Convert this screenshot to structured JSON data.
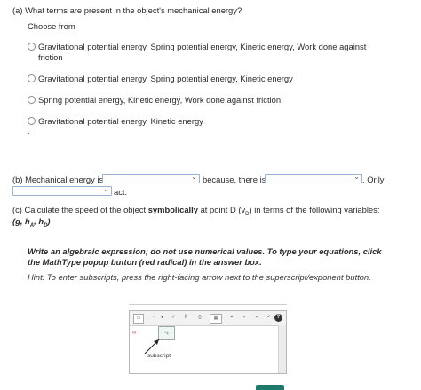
{
  "part_a": {
    "question": "(a) What terms are present in the object's mechanical energy?",
    "choose_from": "Choose from",
    "options": [
      "Gravitational potential energy, Spring potential energy, Kinetic energy, Work done against friction",
      "Gravitational potential energy, Spring potential energy, Kinetic energy",
      "Spring potential energy, Kinetic energy, Work done against friction,",
      "Gravitational potential energy, Kinetic energy"
    ],
    "trailing_mark": "."
  },
  "part_b": {
    "prefix": "(b) Mechanical energy is",
    "middle": "because, there is",
    "suffix": ". Only",
    "end": "act."
  },
  "part_c": {
    "line1_start": "(c) Calculate the speed of the object ",
    "line1_bold": "symbolically",
    "line1_end": " at point D (v",
    "line1_sub": "D",
    "line1_close": ") in terms of the following variables:",
    "variables": "(g, h",
    "var_sub1": "A",
    "var_mid": ", h",
    "var_sub2": "D",
    "var_close": ")"
  },
  "instructions": "Write an algebraic expression; do not use numerical values. To type your equations, click the MathType popup button (red radical) in the answer box.",
  "hint": "Hint: To enter subscripts, press the right-facing arrow next to the superscript/exponent button.",
  "editor": {
    "subscript_label": "subscript",
    "help_label": "?"
  },
  "colors": {
    "select_border": "#9cb3cf",
    "accent_green": "#1f7a6c"
  }
}
